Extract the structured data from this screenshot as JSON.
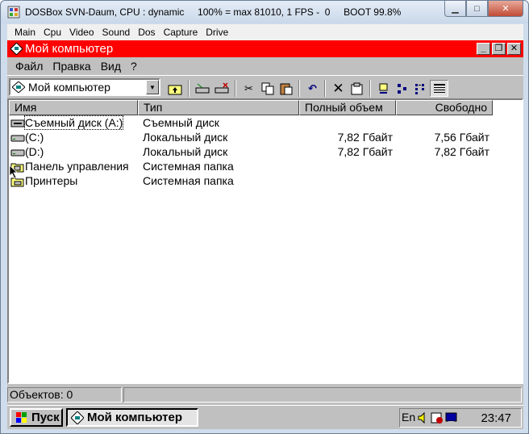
{
  "host": {
    "title": "DOSBox SVN-Daum, CPU : dynamic     100% = max 81010, 1 FPS -  0     BOOT 99.8%",
    "menu": [
      "Main",
      "Cpu",
      "Video",
      "Sound",
      "Dos",
      "Capture",
      "Drive"
    ]
  },
  "window": {
    "title": "Мой компьютер",
    "menu": {
      "file": "Файл",
      "edit": "Правка",
      "view": "Вид",
      "help": "?"
    },
    "address": "Мой компьютер"
  },
  "listview": {
    "columns": [
      "Имя",
      "Тип",
      "Полный объем",
      "Свободно"
    ],
    "rows": [
      {
        "name": "Съемный диск (A:)",
        "type": "Съемный диск",
        "size": "",
        "free": "",
        "icon": "floppy-drive-icon"
      },
      {
        "name": "(C:)",
        "type": "Локальный диск",
        "size": "7,82 Гбайт",
        "free": "7,56 Гбайт",
        "icon": "hard-drive-icon"
      },
      {
        "name": "(D:)",
        "type": "Локальный диск",
        "size": "7,82 Гбайт",
        "free": "7,82 Гбайт",
        "icon": "hard-drive-icon"
      },
      {
        "name": "Панель управления",
        "type": "Системная папка",
        "size": "",
        "free": "",
        "icon": "control-panel-folder-icon"
      },
      {
        "name": "Принтеры",
        "type": "Системная папка",
        "size": "",
        "free": "",
        "icon": "printers-folder-icon"
      }
    ]
  },
  "status": {
    "objects": "Объектов: 0"
  },
  "taskbar": {
    "start": "Пуск",
    "task": "Мой компьютер",
    "lang": "En",
    "clock": "23:47"
  },
  "colors": {
    "title_bar": "#ff0000",
    "face": "#c0c0c0"
  }
}
